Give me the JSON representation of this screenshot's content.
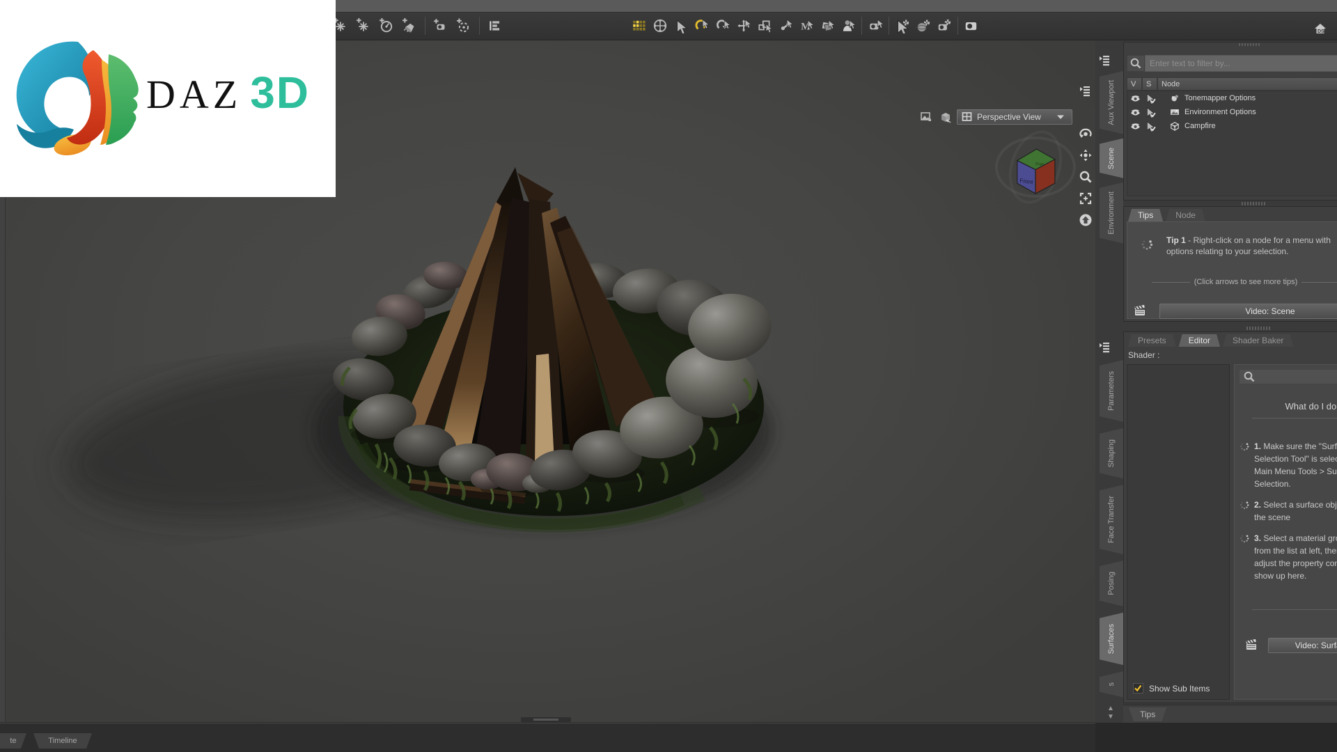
{
  "logo": {
    "daz": "DAZ",
    "threed": "3D"
  },
  "toolbar": {
    "group_a": [
      "sparkle-plus",
      "sparkle-plus",
      "gauge-plus",
      "spotlight-plus",
      "divider",
      "camera-cone-plus",
      "orbit-plus",
      "divider",
      "align-list"
    ],
    "group_b": [
      "grid",
      "globe-move",
      "cursor",
      "rotate-cursor",
      "rotate",
      "move",
      "scale",
      "bone",
      "m-cursor",
      "layers",
      "person",
      "divider",
      "camera-plus",
      "divider",
      "cursor-gear",
      "sphere-gear",
      "camera-gear",
      "divider",
      "camera"
    ]
  },
  "top_right_app_icon": "DS",
  "viewport": {
    "view_dropdown": "Perspective View",
    "cube_top": "Top",
    "cube_front": "Front",
    "tools": [
      "pane-menu",
      "orbit",
      "pan",
      "zoom",
      "frame",
      "home"
    ]
  },
  "side_tabs_top": [
    {
      "label": "Aux Viewport",
      "active": false
    },
    {
      "label": "Scene",
      "active": true
    },
    {
      "label": "Environment",
      "active": false
    }
  ],
  "side_tabs_bottom": [
    {
      "label": "Parameters",
      "active": false
    },
    {
      "label": "Shaping",
      "active": false
    },
    {
      "label": "Face Transfer",
      "active": false
    },
    {
      "label": "Posing",
      "active": false
    },
    {
      "label": "Surfaces",
      "active": true
    },
    {
      "label": "s",
      "active": false
    }
  ],
  "scene_panel": {
    "filter_placeholder": "Enter text to filter by...",
    "columns": [
      "V",
      "S",
      "Node"
    ],
    "nodes": [
      {
        "label": "Tonemapper Options",
        "icon": "tonemapper"
      },
      {
        "label": "Environment Options",
        "icon": "environment"
      },
      {
        "label": "Campfire",
        "icon": "cube"
      }
    ]
  },
  "tips_panel": {
    "tabs": [
      {
        "label": "Tips",
        "active": true
      },
      {
        "label": "Node",
        "active": false
      }
    ],
    "tip_title": "Tip 1",
    "tip_text": " - Right-click on a node for a menu with options relating to your selection.",
    "more_tips": "(Click arrows to see more tips)",
    "video_button": "Video: Scene"
  },
  "editor_panel": {
    "tabs": [
      {
        "label": "Presets",
        "active": false
      },
      {
        "label": "Editor",
        "active": true
      },
      {
        "label": "Shader Baker",
        "active": false
      }
    ],
    "shader_label": "Shader :",
    "help_title": "What do I do?",
    "steps": [
      {
        "num": "1.",
        "text": "Make sure the \"Surface Selection Tool\" is selected. Main Menu Tools > Surface Selection."
      },
      {
        "num": "2.",
        "text": "Select a surface object in the scene"
      },
      {
        "num": "3.",
        "text": "Select a material group from the list at left, then adjust the property controls show up here."
      }
    ],
    "video_button": "Video: Surfaces",
    "show_sub_items": "Show Sub Items"
  },
  "bottom_right_tab": "Tips",
  "bottom_bar": {
    "tabs": [
      "te",
      "Timeline"
    ]
  }
}
